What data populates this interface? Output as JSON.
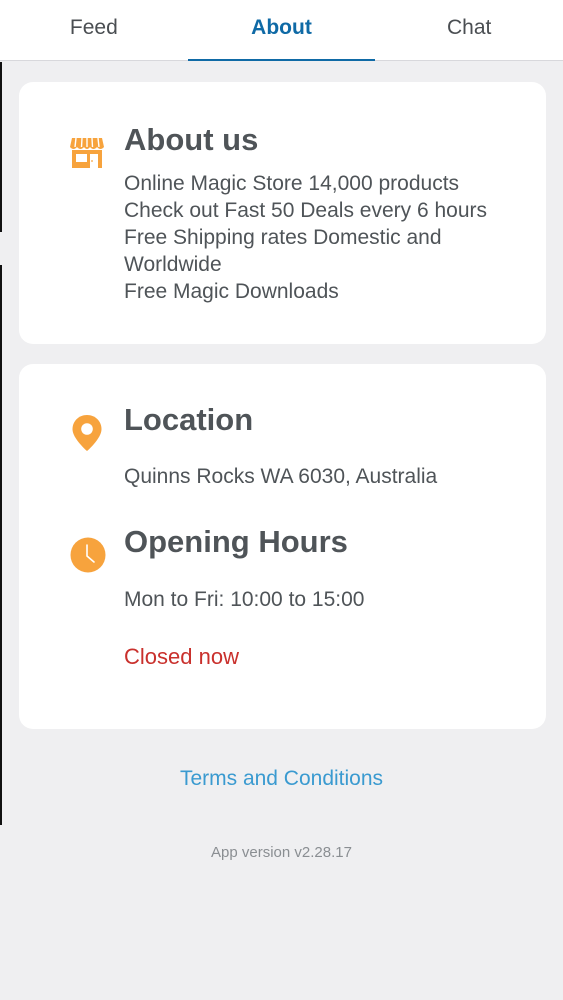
{
  "tabs": [
    {
      "label": "Feed",
      "active": false
    },
    {
      "label": "About",
      "active": true
    },
    {
      "label": "Chat",
      "active": false
    }
  ],
  "about": {
    "icon": "store-icon",
    "title": "About us",
    "lines": [
      "Online Magic Store 14,000 products",
      "Check out Fast 50 Deals every 6 hours",
      "Free Shipping rates Domestic and Worldwide",
      "Free Magic Downloads"
    ]
  },
  "location": {
    "icon": "location-pin-icon",
    "title": "Location",
    "address": "Quinns Rocks WA 6030, Australia"
  },
  "hours": {
    "icon": "clock-icon",
    "title": "Opening Hours",
    "schedule": "Mon to Fri: 10:00 to 15:00",
    "status": "Closed now"
  },
  "footer": {
    "terms_label": "Terms and Conditions",
    "version": "App version v2.28.17"
  },
  "colors": {
    "accent": "#0f6aa6",
    "icon_orange": "#f7a33d",
    "link": "#3a9ad0",
    "closed": "#c9302c",
    "background": "#efeff1"
  }
}
